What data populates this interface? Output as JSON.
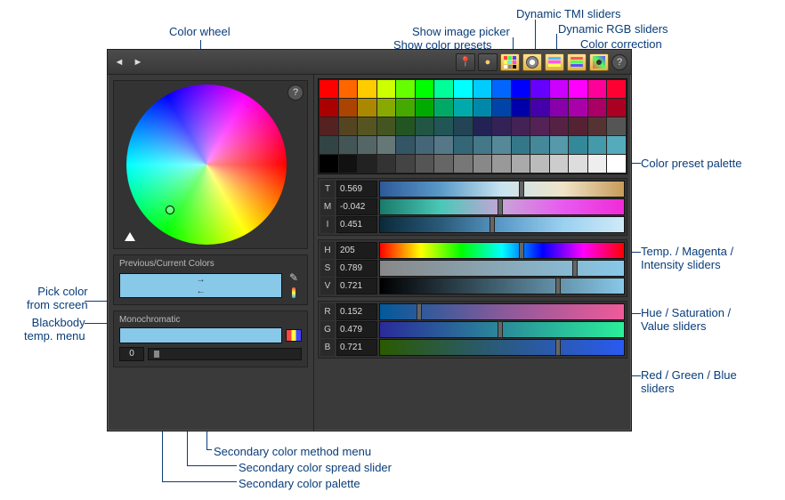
{
  "annotations": {
    "color_wheel": "Color wheel",
    "show_image_picker": "Show image picker",
    "show_color_presets": "Show color presets",
    "dynamic_tmi": "Dynamic TMI sliders",
    "dynamic_rgb": "Dynamic RGB sliders",
    "color_correction": "Color correction",
    "preset_palette": "Color preset palette",
    "tmi_sliders": "Temp. / Magenta /\nIntensity sliders",
    "hsv_sliders": "Hue / Saturation /\nValue sliders",
    "rgb_sliders": "Red / Green / Blue\nsliders",
    "pick_from_screen": "Pick color\nfrom screen",
    "blackbody_menu": "Blackbody\ntemp. menu",
    "sec_method": "Secondary color method menu",
    "sec_spread": "Secondary color spread slider",
    "sec_palette": "Secondary color palette"
  },
  "toolbar": {
    "back": "◄",
    "forward": "►"
  },
  "sections": {
    "prev_current": "Previous/Current Colors",
    "monochromatic": "Monochromatic"
  },
  "mono_value": "0",
  "sliders": {
    "tmi": [
      {
        "label": "T",
        "value": "0.569",
        "pos": 0.57
      },
      {
        "label": "M",
        "value": "-0.042",
        "pos": 0.48
      },
      {
        "label": "I",
        "value": "0.451",
        "pos": 0.45
      }
    ],
    "hsv": [
      {
        "label": "H",
        "value": "205",
        "pos": 0.57
      },
      {
        "label": "S",
        "value": "0.789",
        "pos": 0.79
      },
      {
        "label": "V",
        "value": "0.721",
        "pos": 0.72
      }
    ],
    "rgb": [
      {
        "label": "R",
        "value": "0.152",
        "pos": 0.15
      },
      {
        "label": "G",
        "value": "0.479",
        "pos": 0.48
      },
      {
        "label": "B",
        "value": "0.721",
        "pos": 0.72
      }
    ]
  },
  "preset_colors": [
    "#ff0000",
    "#ff6600",
    "#ffcc00",
    "#ccff00",
    "#66ff00",
    "#00ff00",
    "#00ff99",
    "#00ffff",
    "#00ccff",
    "#0066ff",
    "#0000ff",
    "#6600ff",
    "#cc00ff",
    "#ff00ff",
    "#ff0099",
    "#ff0033",
    "#aa0000",
    "#aa4400",
    "#aa8800",
    "#88aa00",
    "#44aa00",
    "#00aa00",
    "#00aa66",
    "#00aaaa",
    "#0088aa",
    "#0044aa",
    "#0000aa",
    "#4400aa",
    "#8800aa",
    "#aa00aa",
    "#aa0066",
    "#aa0022",
    "#552222",
    "#554422",
    "#555522",
    "#445522",
    "#225522",
    "#225544",
    "#225555",
    "#224455",
    "#222255",
    "#332255",
    "#442255",
    "#552255",
    "#552244",
    "#552233",
    "#553333",
    "#555555",
    "#334444",
    "#445555",
    "#556666",
    "#667777",
    "#335566",
    "#446677",
    "#557788",
    "#336677",
    "#447788",
    "#558899",
    "#337788",
    "#448899",
    "#5599aa",
    "#338899",
    "#4499aa",
    "#55aabb",
    "#000000",
    "#111111",
    "#222222",
    "#333333",
    "#444444",
    "#555555",
    "#666666",
    "#777777",
    "#888888",
    "#999999",
    "#aaaaaa",
    "#bbbbbb",
    "#cccccc",
    "#dddddd",
    "#eeeeee",
    "#ffffff"
  ]
}
